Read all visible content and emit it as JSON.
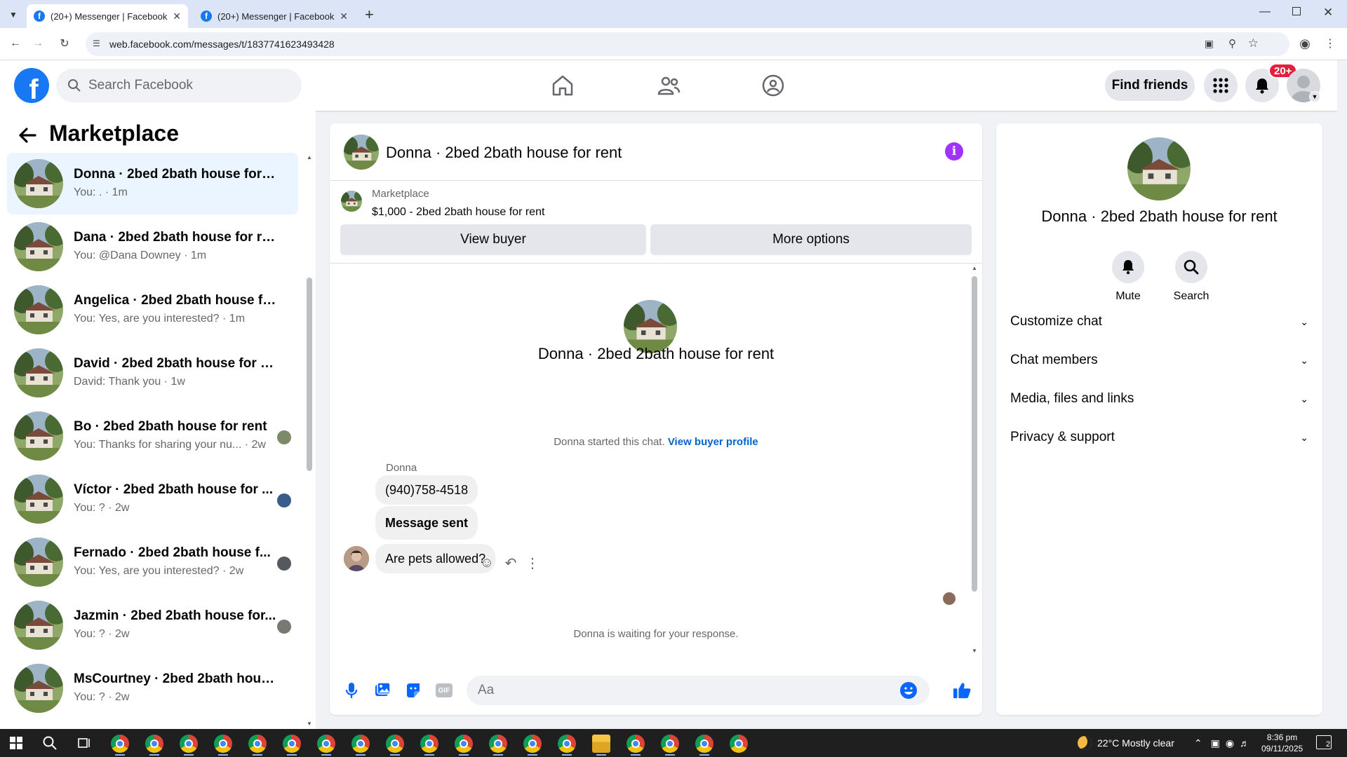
{
  "browser": {
    "tabs": [
      {
        "title": "(20+) Messenger | Facebook",
        "active": true
      },
      {
        "title": "(20+) Messenger | Facebook",
        "active": false
      }
    ],
    "url": "web.facebook.com/messages/t/1837741623493428"
  },
  "header": {
    "search_placeholder": "Search Facebook",
    "find_friends": "Find friends",
    "notif_badge": "20+"
  },
  "left": {
    "title": "Marketplace",
    "conversations": [
      {
        "name": "Donna · 2bed 2bath house for rent",
        "snippet": "You: . · 1m",
        "selected": true
      },
      {
        "name": "Dana · 2bed 2bath house for rent",
        "snippet": "You: @Dana Downey · 1m"
      },
      {
        "name": "Angelica · 2bed 2bath house for ...",
        "snippet": "You: Yes, are you interested? · 1m"
      },
      {
        "name": "David · 2bed 2bath house for rent",
        "snippet": "David: Thank you · 1w"
      },
      {
        "name": "Bo · 2bed 2bath house for rent",
        "snippet": "You: Thanks for sharing your nu...  · 2w"
      },
      {
        "name": "Víctor · 2bed 2bath house for ...",
        "snippet": "You: ? · 2w"
      },
      {
        "name": "Fernado · 2bed 2bath house f...",
        "snippet": "You: Yes, are you interested? · 2w"
      },
      {
        "name": "Jazmin · 2bed 2bath house for...",
        "snippet": "You: ? · 2w"
      },
      {
        "name": "MsCourtney · 2bed 2bath house ...",
        "snippet": "You: ? · 2w"
      }
    ]
  },
  "chat": {
    "title": "Donna · 2bed 2bath house for rent",
    "banner_label": "Marketplace",
    "banner_listing": "$1,000 - 2bed 2bath house for rent",
    "view_buyer": "View buyer",
    "more_options": "More options",
    "center_name": "Donna · 2bed 2bath house for rent",
    "started_note": "Donna started this chat.",
    "view_buyer_profile": "View buyer profile",
    "sender": "Donna",
    "messages": [
      "(940)758-4518",
      "Message sent",
      "Are pets allowed?"
    ],
    "waiting": "Donna is waiting for your response.",
    "input_placeholder": "Aa"
  },
  "right": {
    "name": "Donna · 2bed 2bath house for rent",
    "mute": "Mute",
    "search": "Search",
    "sections": [
      "Customize chat",
      "Chat members",
      "Media, files and links",
      "Privacy & support"
    ]
  },
  "taskbar": {
    "weather": "22°C  Mostly clear",
    "time": "8:36 pm",
    "date": "09/11/2025",
    "notifications": "2"
  },
  "colors": {
    "brand": "#1877f2",
    "info_purple": "#a033ff",
    "link": "#0064d1",
    "badge": "#e41e3f"
  }
}
